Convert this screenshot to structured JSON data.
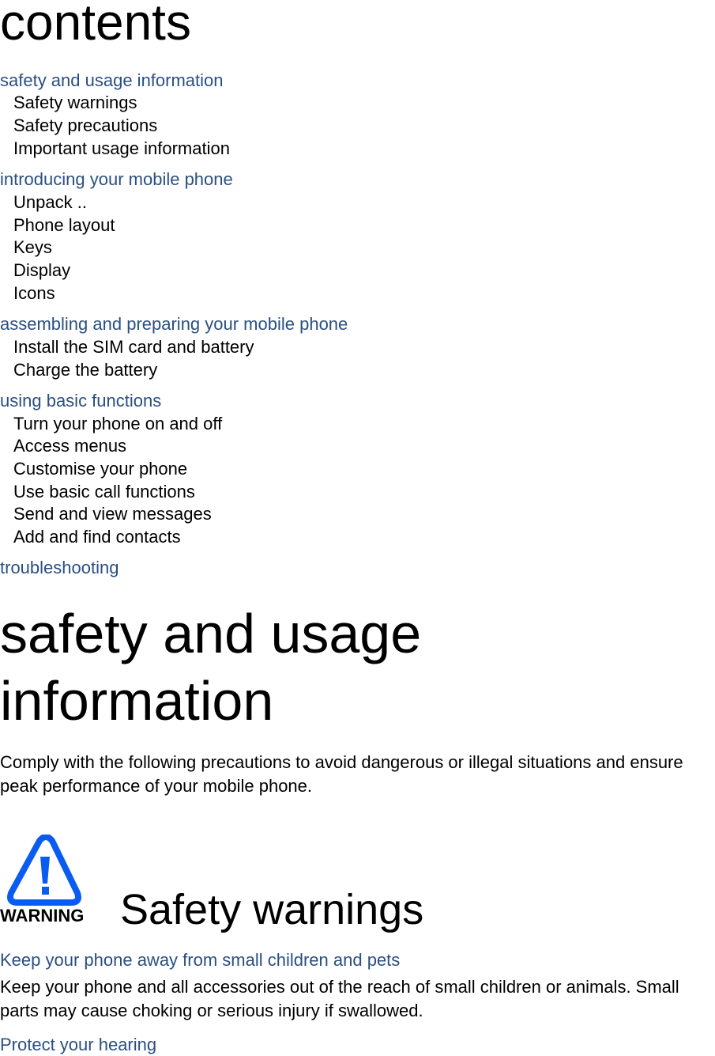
{
  "contents": {
    "title": "contents",
    "sections": [
      {
        "heading": "safety and usage information",
        "items": [
          "Safety warnings",
          "Safety precautions",
          "Important usage information"
        ]
      },
      {
        "heading": "introducing your mobile phone",
        "items": [
          "Unpack  ..",
          "Phone layout",
          "Keys",
          "Display",
          "Icons"
        ]
      },
      {
        "heading": "assembling and preparing your mobile phone",
        "items": [
          "Install the SIM card and battery",
          "Charge the battery"
        ]
      },
      {
        "heading": "using basic functions",
        "items": [
          "Turn your phone on and off",
          "Access menus",
          "Customise your phone",
          "Use basic call functions",
          "Send and view messages",
          "Add and find contacts"
        ]
      },
      {
        "heading": "troubleshooting",
        "items": []
      }
    ]
  },
  "chapter": {
    "title_line1": "safety and usage",
    "title_line2": "information",
    "intro": "Comply with the following precautions to avoid dangerous or illegal situations and ensure peak performance of your mobile phone."
  },
  "warnings": {
    "icon_label": "WARNING",
    "icon_color": "#0a5cf0",
    "title": "Safety warnings",
    "subsections": [
      {
        "heading": "Keep your phone away from small children and pets",
        "body": "Keep your phone and all accessories out of the reach of small children or animals. Small parts may cause choking or serious injury if swallowed."
      },
      {
        "heading": "Protect your hearing"
      }
    ]
  }
}
